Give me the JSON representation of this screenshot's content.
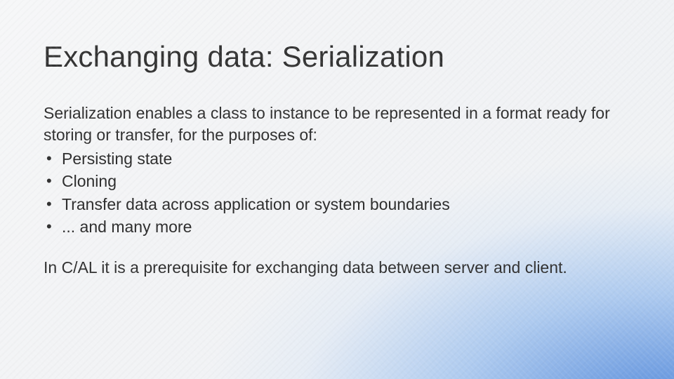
{
  "slide": {
    "title": "Exchanging data: Serialization",
    "intro": "Serialization enables a class to instance to be represented in a format ready for storing or transfer, for the purposes of:",
    "bullets": [
      "Persisting state",
      "Cloning",
      "Transfer data across application or system boundaries",
      "... and many more"
    ],
    "footnote": "In C/AL it is a prerequisite for exchanging data between server and client."
  }
}
